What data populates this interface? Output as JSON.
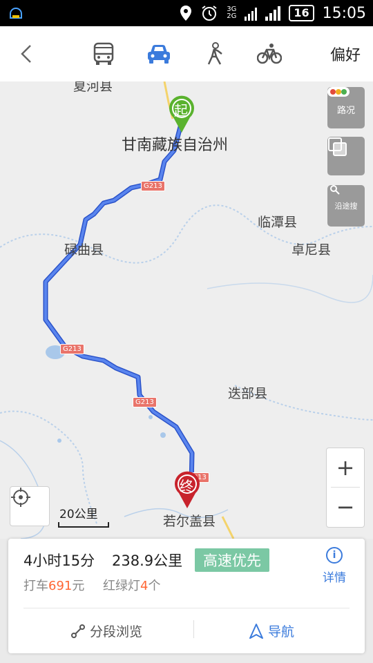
{
  "status_bar": {
    "network": [
      "3G",
      "2G"
    ],
    "battery": "16",
    "time": "15:05",
    "icons": [
      "app-notification-icon",
      "location-icon",
      "alarm-icon",
      "signal-icon",
      "signal-icon"
    ]
  },
  "top_bar": {
    "back_icon": "chevron-left-icon",
    "modes": [
      {
        "name": "bus",
        "icon": "bus-icon",
        "active": false
      },
      {
        "name": "car",
        "icon": "car-icon",
        "active": true
      },
      {
        "name": "walk",
        "icon": "walk-icon",
        "active": false
      },
      {
        "name": "bike",
        "icon": "bike-icon",
        "active": false
      }
    ],
    "preference_label": "偏好"
  },
  "map": {
    "cities": {
      "xiahe": "夏河县",
      "gannan": "甘南藏族自治州",
      "lintan": "临潭县",
      "luqu": "碌曲县",
      "zhuoni": "卓尼县",
      "diebu": "迭部县",
      "ruoergai": "若尔盖县"
    },
    "road_labels": [
      "G213",
      "G213",
      "G213",
      "G213"
    ],
    "start_pin": "起",
    "end_pin": "终",
    "side_buttons": {
      "traffic": "路况",
      "layers_icon": "layers-icon",
      "search_along": "沿途搜"
    },
    "scale": "20公里",
    "zoom_in": "+",
    "zoom_out": "−"
  },
  "route_card": {
    "duration": "4小时15分",
    "distance": "238.9公里",
    "badge": "高速优先",
    "fare_prefix": "打车",
    "fare_value": "691",
    "fare_unit": "元",
    "lights_prefix": "红绿灯",
    "lights_value": "4",
    "lights_unit": "个",
    "detail_label": "详情",
    "segment_label": "分段浏览",
    "navigate_label": "导航"
  },
  "colors": {
    "route": "#4a6fe3",
    "start_pin": "#5ab22e",
    "end_pin": "#c8232c",
    "accent_blue": "#3b7bdc",
    "badge_green": "#7bc8a4"
  }
}
